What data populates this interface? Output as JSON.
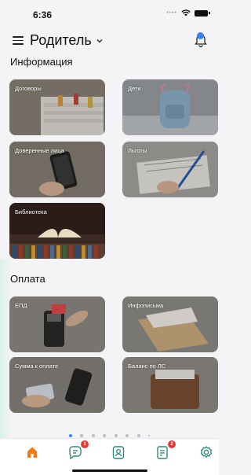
{
  "status_bar": {
    "time": "6:36"
  },
  "header": {
    "title": "Родитель",
    "notification_badge": ""
  },
  "sections": {
    "info": {
      "title": "Информация",
      "tiles": [
        {
          "label": "Договоры"
        },
        {
          "label": "Дети"
        },
        {
          "label": "Доверенные лица"
        },
        {
          "label": "Льготы"
        },
        {
          "label": "Библиотека"
        }
      ]
    },
    "payment": {
      "title": "Оплата",
      "tiles": [
        {
          "label": "ЕПД"
        },
        {
          "label": "Инфописьма"
        },
        {
          "label": "Сумма к оплате"
        },
        {
          "label": "Баланс по ЛС"
        }
      ]
    }
  },
  "pager": {
    "active_index": 0,
    "count": 8
  },
  "tabbar": {
    "tabs": [
      {
        "icon": "home-icon",
        "badge": ""
      },
      {
        "icon": "chat-icon",
        "badge": "1"
      },
      {
        "icon": "contacts-icon",
        "badge": ""
      },
      {
        "icon": "documents-icon",
        "badge": "2"
      },
      {
        "icon": "settings-icon",
        "badge": ""
      }
    ]
  },
  "colors": {
    "accent": "#3b82f6",
    "home_active": "#f07a1a",
    "badge": "#e53935",
    "icon_teal": "#2f8a76"
  }
}
